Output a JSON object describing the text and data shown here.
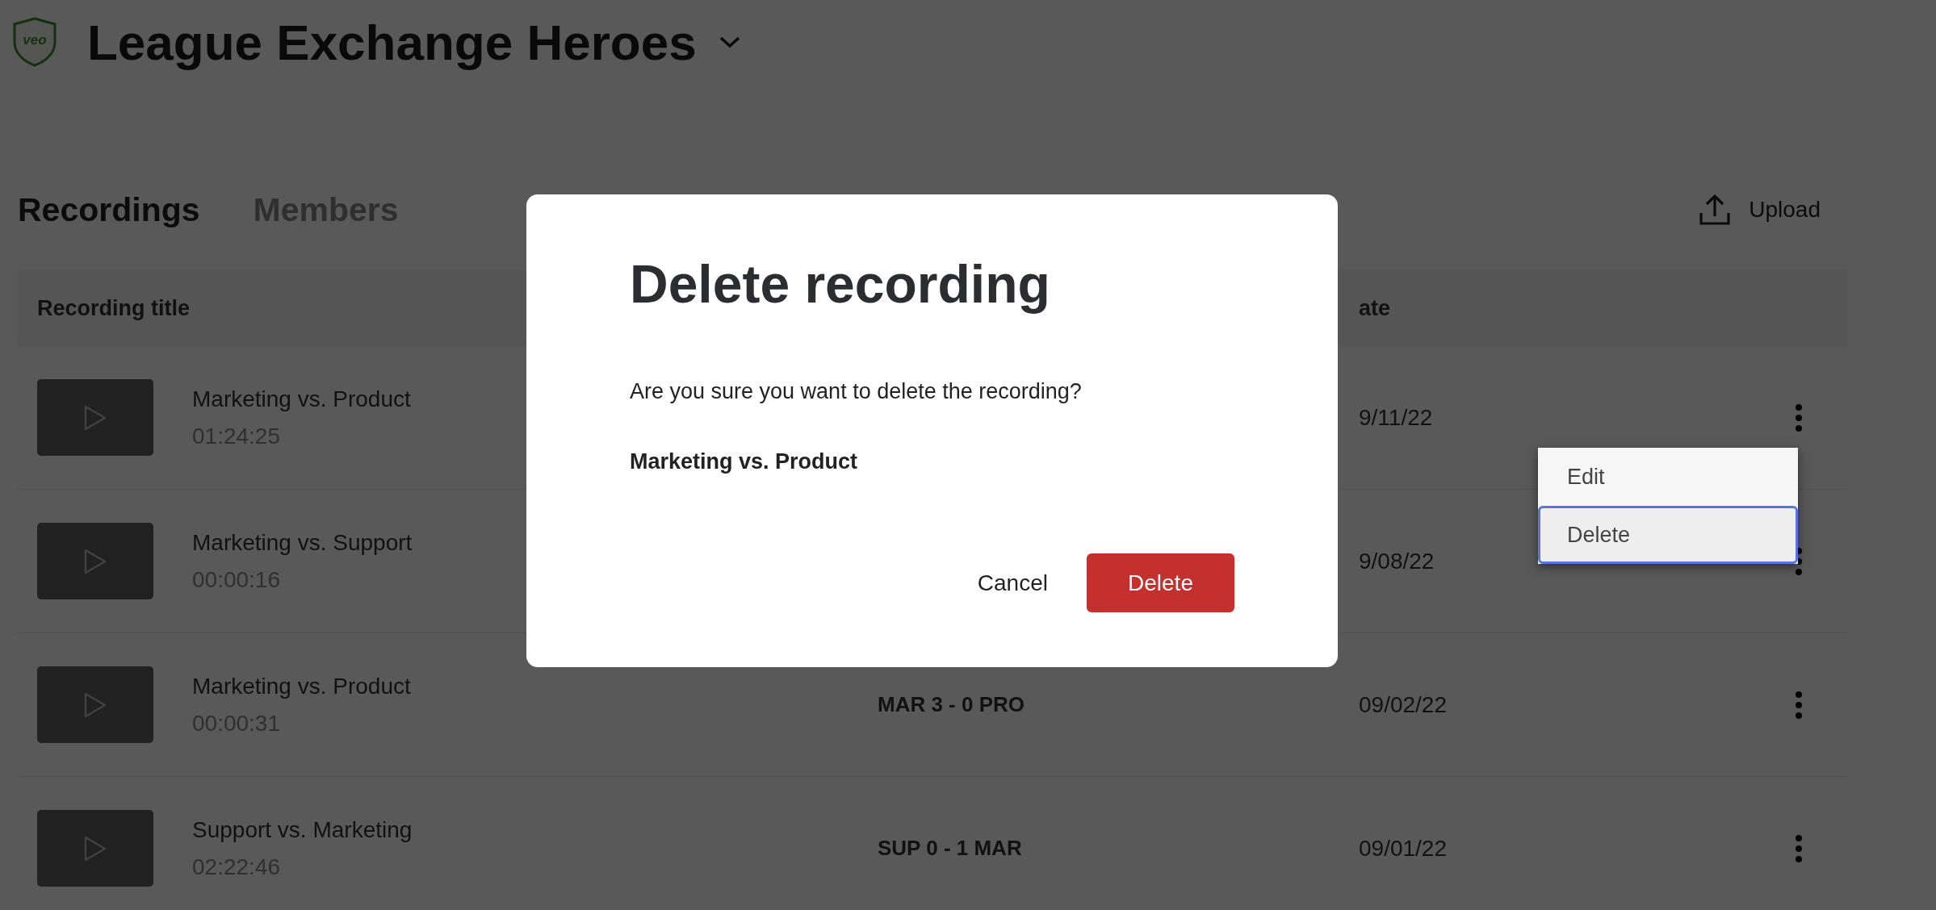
{
  "header": {
    "logo_text": "veo",
    "team_name": "League Exchange Heroes"
  },
  "tabs": [
    {
      "label": "Recordings",
      "selected": true
    },
    {
      "label": "Members",
      "selected": false
    }
  ],
  "upload_button": {
    "label": "Upload"
  },
  "table": {
    "columns": [
      {
        "kind": "title",
        "label": "Recording title"
      },
      {
        "kind": "date",
        "label": "ate"
      }
    ],
    "rows": [
      {
        "title": "Marketing vs. Product",
        "duration": "01:24:25",
        "date": "9/11/22"
      },
      {
        "title": "Marketing vs. Support",
        "duration": "00:00:16",
        "date": "9/08/22"
      },
      {
        "title": "Marketing vs. Product",
        "duration": "00:00:31",
        "score": "MAR 3 - 0 PRO",
        "date": "09/02/22"
      },
      {
        "title": "Support vs. Marketing",
        "duration": "02:22:46",
        "score": "SUP 0 - 1 MAR",
        "date": "09/01/22"
      }
    ]
  },
  "row_menu": {
    "items": [
      {
        "label": "Edit",
        "selected": false
      },
      {
        "label": "Delete",
        "selected": true
      }
    ]
  },
  "dialog": {
    "title": "Delete recording",
    "message": "Are you sure you want to delete the recording?",
    "recording_name": "Marketing vs. Product",
    "buttons": [
      {
        "kind": "secondary",
        "label": "Cancel"
      },
      {
        "kind": "danger",
        "label": "Delete"
      }
    ]
  }
}
